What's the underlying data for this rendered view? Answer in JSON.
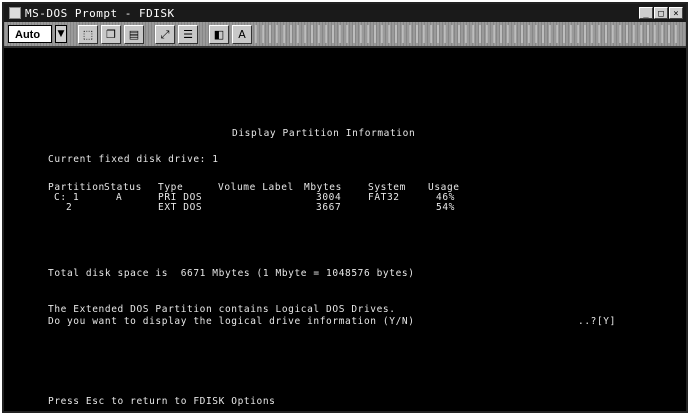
{
  "window": {
    "title": "MS-DOS Prompt - FDISK",
    "buttons": [
      "_",
      "□",
      "×"
    ]
  },
  "toolbar": {
    "font_size_value": "Auto"
  },
  "console": {
    "heading": "Display Partition Information",
    "drive_line": "Current fixed disk drive: 1",
    "columns": [
      "Partition",
      "Status",
      "Type",
      "Volume Label",
      "Mbytes",
      "System",
      "Usage"
    ],
    "rows": [
      {
        "partition": "C: 1",
        "status": "A",
        "type": "PRI DOS",
        "volume": "",
        "mbytes": "3004",
        "system": "FAT32",
        "usage": "46%"
      },
      {
        "partition": "2",
        "status": "",
        "type": "EXT DOS",
        "volume": "",
        "mbytes": "3667",
        "system": "",
        "usage": "54%"
      }
    ],
    "total_space": "Total disk space is  6671 Mbytes (1 Mbyte = 1048576 bytes)",
    "extended_info": "The Extended DOS Partition contains Logical DOS Drives.",
    "prompt_question": "Do you want to display the logical drive information (Y/N)",
    "prompt_answer": "..?[Y]",
    "footer": "Press Esc to return to FDISK Options"
  }
}
